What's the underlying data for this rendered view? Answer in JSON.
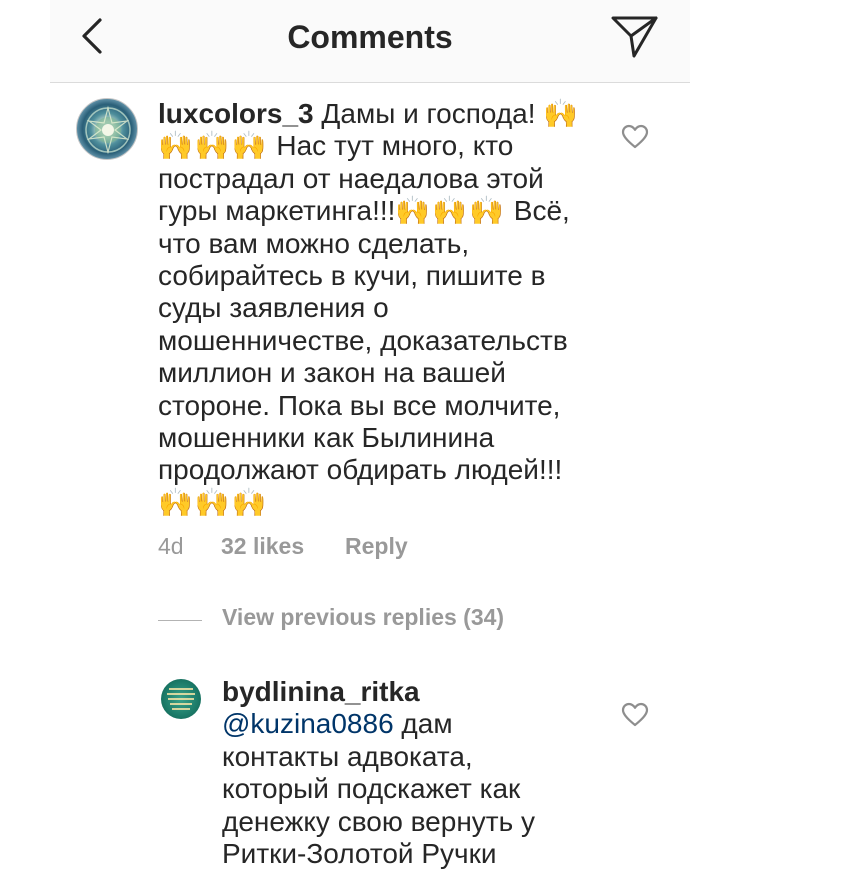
{
  "header": {
    "title": "Comments",
    "back_icon": "chevron-left-icon",
    "share_icon": "paper-plane-icon"
  },
  "comment": {
    "username": "luxcolors_3",
    "part1": "Дамы и господа!",
    "emoji1": "🙌🙌🙌🙌",
    "part2": " Нас тут много, кто пострадал от наедалова этой гуры маркетинга!!!",
    "emoji2": "🙌🙌🙌",
    "part3": " Всё, что вам можно сделать, собирайтесь в кучи, пишите в суды заявления о мошенничестве, доказательств миллион и закон на вашей стороне. Пока вы все молчите, мошенники как Былинина продолжают обдирать людей!!!",
    "emoji3": "🙌🙌🙌",
    "time": "4d",
    "likes": "32 likes",
    "reply": "Reply",
    "like_icon": "heart-outline-icon"
  },
  "replies": {
    "view_label": "View previous replies (34)"
  },
  "reply": {
    "username": "bydlinina_ritka",
    "mention": "@kuzina0886",
    "text": " дам контакты адвоката, который подскажет как денежку свою вернуть у Ритки-Золотой Ручки",
    "like_icon": "heart-outline-icon"
  },
  "colors": {
    "text": "#262626",
    "secondary": "#999999",
    "mention": "#003569",
    "header_bg": "#fafafa",
    "divider": "#dbdbdb"
  }
}
